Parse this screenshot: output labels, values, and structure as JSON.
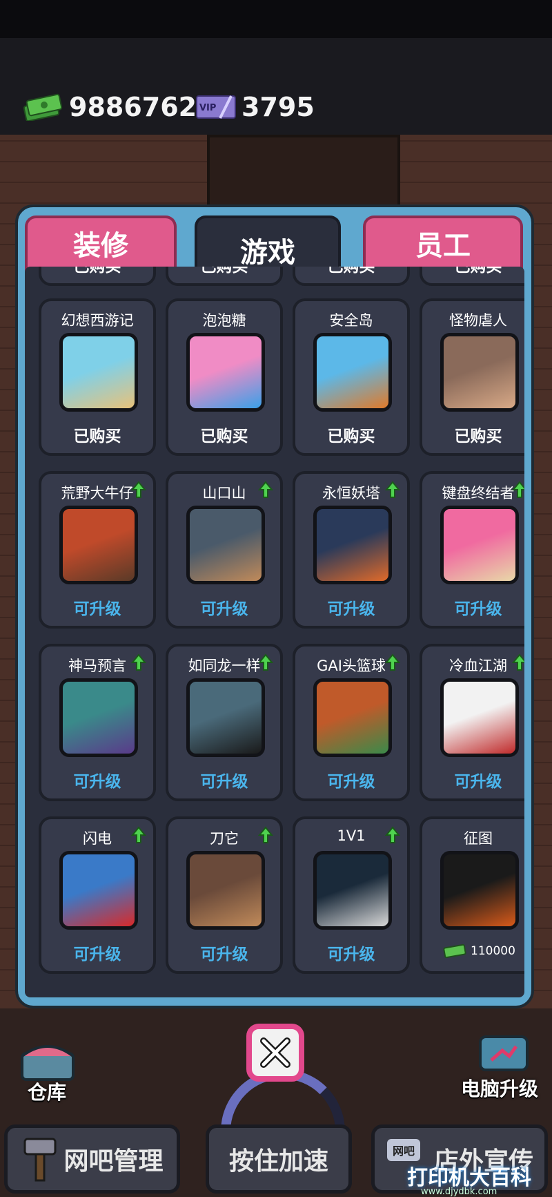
{
  "hud": {
    "money": "9886762",
    "vip_label": "VIP",
    "vip_value": "3795"
  },
  "tabs": [
    {
      "label": "装修",
      "active": false
    },
    {
      "label": "游戏",
      "active": true
    },
    {
      "label": "员工",
      "active": false
    }
  ],
  "partial_row": [
    "已购买",
    "已购买",
    "已购买",
    "已购买"
  ],
  "cards": [
    {
      "name": "幻想西游记",
      "status": "已购买",
      "kind": "bought",
      "upgrade": false,
      "colors": [
        "#7fd0e8",
        "#e8c27a"
      ]
    },
    {
      "name": "泡泡糖",
      "status": "已购买",
      "kind": "bought",
      "upgrade": false,
      "colors": [
        "#f08cc5",
        "#3aa0e8"
      ]
    },
    {
      "name": "安全岛",
      "status": "已购买",
      "kind": "bought",
      "upgrade": false,
      "colors": [
        "#5cb8e8",
        "#e07a2a"
      ]
    },
    {
      "name": "怪物虐人",
      "status": "已购买",
      "kind": "bought",
      "upgrade": false,
      "colors": [
        "#8a6a5a",
        "#d8a987"
      ]
    },
    {
      "name": "荒野大牛仔",
      "status": "可升级",
      "kind": "upgrade",
      "upgrade": true,
      "colors": [
        "#c04a2a",
        "#5a3a28"
      ]
    },
    {
      "name": "山口山",
      "status": "可升级",
      "kind": "upgrade",
      "upgrade": true,
      "colors": [
        "#4a5a6a",
        "#c08a5a"
      ]
    },
    {
      "name": "永恒妖塔",
      "status": "可升级",
      "kind": "upgrade",
      "upgrade": true,
      "colors": [
        "#2a3a5a",
        "#e06a2a"
      ]
    },
    {
      "name": "键盘终结者",
      "status": "可升级",
      "kind": "upgrade",
      "upgrade": true,
      "colors": [
        "#f06aa0",
        "#e8d8a8"
      ]
    },
    {
      "name": "神马预言",
      "status": "可升级",
      "kind": "upgrade",
      "upgrade": true,
      "colors": [
        "#3a8a8a",
        "#5a3a8a"
      ]
    },
    {
      "name": "如同龙一样",
      "status": "可升级",
      "kind": "upgrade",
      "upgrade": true,
      "colors": [
        "#4a6a7a",
        "#1a1a1a"
      ]
    },
    {
      "name": "GAI头篮球",
      "status": "可升级",
      "kind": "upgrade",
      "upgrade": true,
      "colors": [
        "#c05a2a",
        "#3a8a4a"
      ]
    },
    {
      "name": "冷血江湖",
      "status": "可升级",
      "kind": "upgrade",
      "upgrade": true,
      "colors": [
        "#f2f2f2",
        "#c02a2a"
      ]
    },
    {
      "name": "闪电",
      "status": "可升级",
      "kind": "upgrade",
      "upgrade": true,
      "colors": [
        "#3a7ac8",
        "#d82a2a"
      ]
    },
    {
      "name": "刀它",
      "status": "可升级",
      "kind": "upgrade",
      "upgrade": true,
      "colors": [
        "#6a4a3a",
        "#c08a5a"
      ]
    },
    {
      "name": "1V1",
      "status": "可升级",
      "kind": "upgrade",
      "upgrade": true,
      "colors": [
        "#1a2a3a",
        "#d8d8d8"
      ]
    },
    {
      "name": "征图",
      "status": "",
      "kind": "price",
      "upgrade": false,
      "price": "110000",
      "colors": [
        "#1a1a1a",
        "#d85a1a"
      ]
    }
  ],
  "bottom": {
    "warehouse_label": "仓库",
    "pc_upgrade_label": "电脑升级",
    "manage_label": "网吧管理",
    "speedup_label": "按住加速",
    "promote_label": "店外宣传",
    "badge_label": "网吧"
  },
  "watermark": {
    "main": "打印机大百科",
    "sub": "www.djydbk.com"
  }
}
